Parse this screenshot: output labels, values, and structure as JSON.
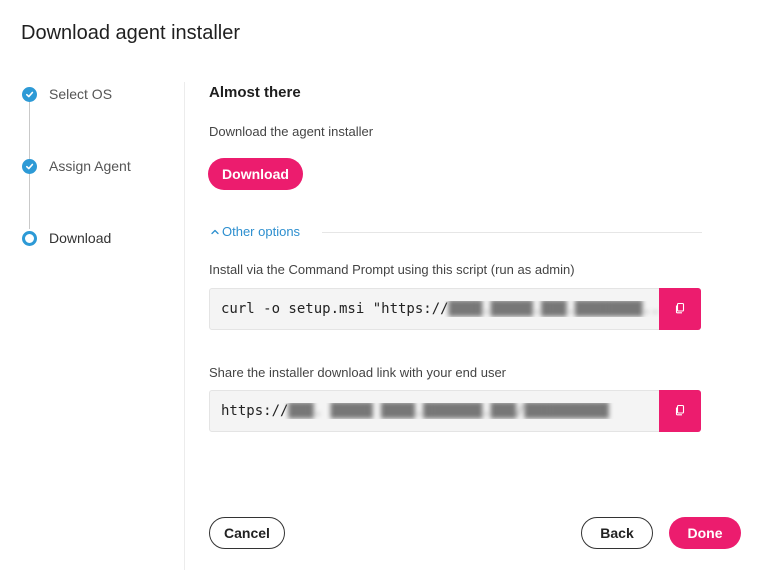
{
  "dialog": {
    "title": "Download agent installer"
  },
  "steps": [
    {
      "label": "Select OS",
      "status": "complete"
    },
    {
      "label": "Assign Agent",
      "status": "complete"
    },
    {
      "label": "Download",
      "status": "current"
    }
  ],
  "main": {
    "heading": "Almost there",
    "download_text": "Download the agent installer",
    "download_button": "Download",
    "other_options_label": "Other options",
    "script_label": "Install via the Command Prompt using this script (run as admin)",
    "script_prefix": "curl -o setup.msi \"https://",
    "script_redacted": "████.█████.███.████████...",
    "link_label": "Share the installer download link with your end user",
    "link_prefix": "https://",
    "link_redacted": "███. █████ ████.███████.███/██████████"
  },
  "footer": {
    "cancel_label": "Cancel",
    "back_label": "Back",
    "done_label": "Done"
  },
  "colors": {
    "accent": "#ec1c6e",
    "step_blue": "#2d9ad6",
    "link_blue": "#2d8fcf"
  },
  "icons": {
    "step_complete": "check-circle-icon",
    "step_current": "radio-circle-icon",
    "options_toggle": "chevron-up-icon",
    "copy": "copy-icon"
  }
}
